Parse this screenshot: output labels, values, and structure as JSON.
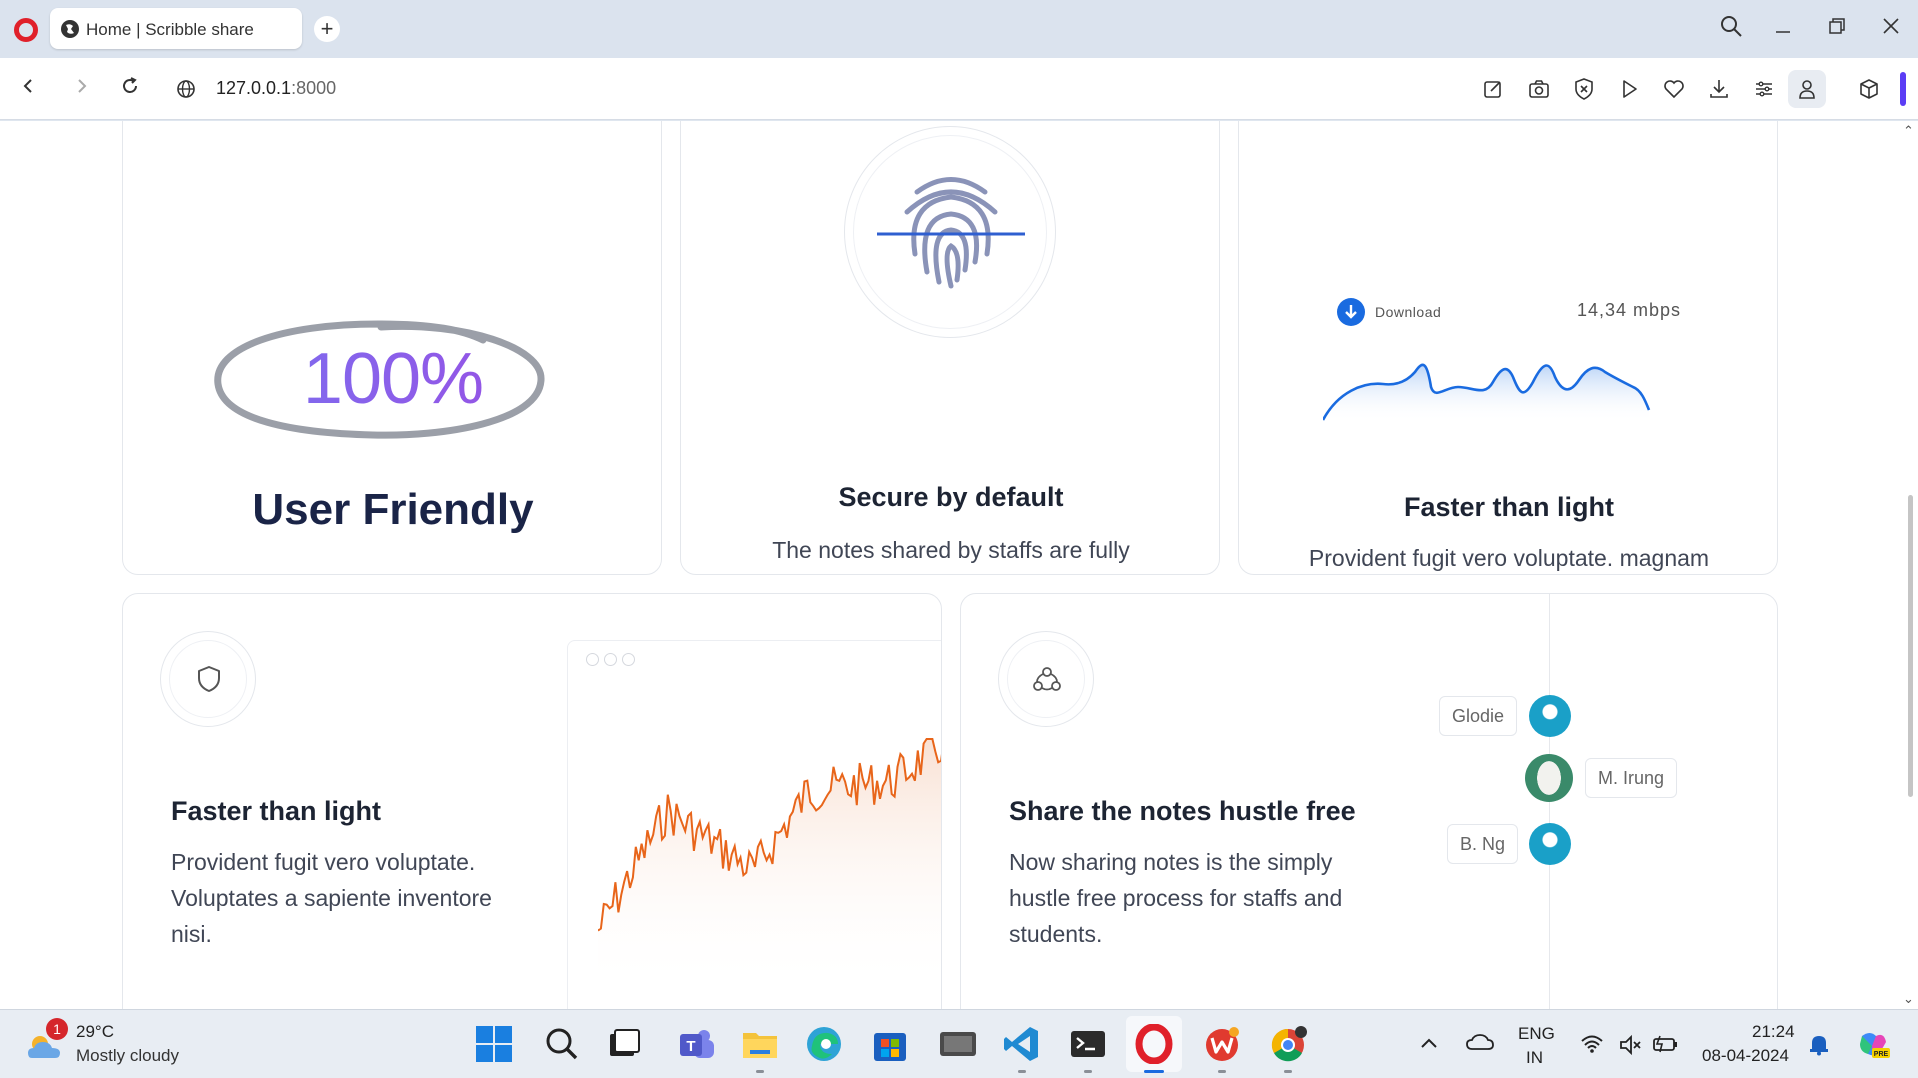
{
  "browser": {
    "tab_title": "Home | Scribble share",
    "new_tab": "+",
    "url_host": "127.0.0.1",
    "url_port": ":8000"
  },
  "cards": {
    "user_friendly": {
      "percent": "100%",
      "title": "User Friendly"
    },
    "secure": {
      "title": "Secure by default",
      "body": "The notes shared by staffs are fully secured and the data are protectable"
    },
    "speed": {
      "download_label": "Download",
      "download_speed": "14,34 mbps",
      "title": "Faster than light",
      "body": "Provident fugit vero voluptate. magnam magni doloribus dolores voluptates inventore nisi."
    },
    "faster": {
      "title": "Faster than light",
      "body": "Provident fugit vero voluptate. Voluptates a sapiente inventore nisi."
    },
    "share": {
      "title": "Share the notes hustle free",
      "body": "Now sharing notes is the simply hustle free process for staffs and students.",
      "people": [
        "Glodie",
        "M. Irung",
        "B. Ng"
      ]
    }
  },
  "taskbar": {
    "weather_badge": "1",
    "weather_temp": "29°C",
    "weather_desc": "Mostly cloudy",
    "lang_top": "ENG",
    "lang_bottom": "IN",
    "time": "21:24",
    "date": "08-04-2024"
  },
  "colors": {
    "accent": "#5b3df5",
    "heading": "#1a2447",
    "download_blue": "#1a6be0",
    "stock_line": "#e8651a"
  }
}
